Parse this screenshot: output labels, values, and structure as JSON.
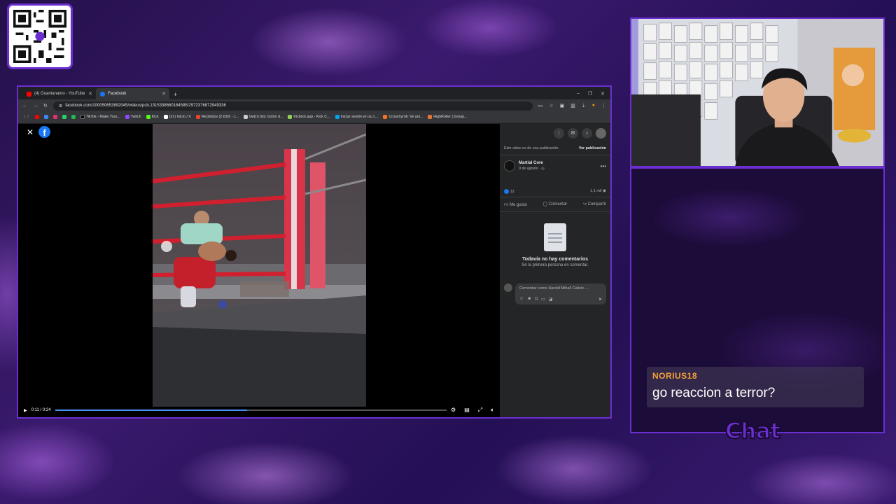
{
  "browser": {
    "tabs": [
      {
        "label": "(4) Guantanamo - YouTube",
        "active": false,
        "favicon": "youtube-icon"
      },
      {
        "label": "Facebook",
        "active": true,
        "favicon": "facebook-icon"
      }
    ],
    "url": "facebook.com/100050653892045/videos/pcb.1315338660164585/2972376872949336",
    "bookmarks": [
      "TikTok - Make Your...",
      "Twitch",
      "Kick",
      "(21) Inicio / X",
      "Recibidos (2,630) - c...",
      "twitch bits: botón d...",
      "Kickbot.app - Kick C...",
      "Iniciar sesión en su c...",
      "Crunchyroll: Ve ani...",
      "HighRoller | Group..."
    ]
  },
  "video": {
    "time": "0:11 / 0:24",
    "progress": 0.49
  },
  "sidebar": {
    "note": "Este video es de una publicación.",
    "note_link": "Ver publicación",
    "author": "Martial Core",
    "date": "9 de agosto · ",
    "likes": "12",
    "views": "1,1 mil",
    "actions": {
      "like": "Me gusta",
      "comment": "Comentar",
      "share": "Compartir"
    },
    "no_comments": "Todavía no hay comentarios",
    "no_comments_sub": "Sé la primera persona en comentar.",
    "comment_placeholder": "Comentar como Harold Mihail Calixto ..."
  },
  "chat": {
    "username": "NORIUS18",
    "message": "go reaccion a terror?",
    "title": "Chat"
  },
  "colors": {
    "accent": "#6b2fd1",
    "username": "#f2a13a",
    "facebook": "#1877f2"
  }
}
